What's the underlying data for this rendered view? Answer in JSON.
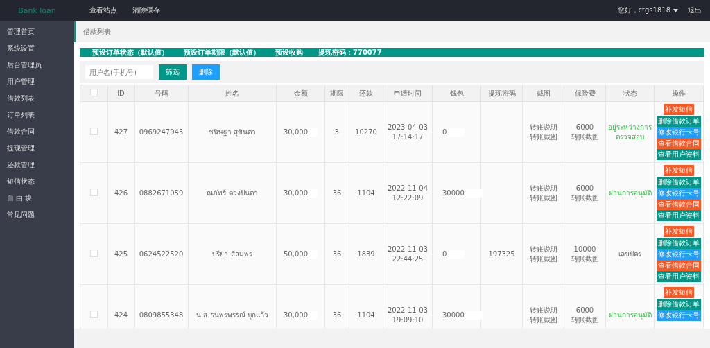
{
  "header": {
    "brand": "Bank loan",
    "nav": [
      "查看站点",
      "清除缓存"
    ],
    "user": "您好，ctgs1818",
    "logout": "退出"
  },
  "sidebar": {
    "items": [
      "管理首页",
      "系统设置",
      "后台管理员",
      "用户管理",
      "借款列表",
      "订单列表",
      "借款合同",
      "提现管理",
      "还款管理",
      "短信状态",
      "自 由 块",
      "常见问题"
    ]
  },
  "breadcrumb": "借款列表",
  "notice": [
    "预设订单状态（默认值）",
    "预设订单期限（默认值）",
    "预设收购",
    "提现密码：770077"
  ],
  "filter": {
    "placeholder": "用户名(手机号)",
    "buttons": [
      {
        "label": "筛选",
        "kind": "primary"
      },
      {
        "label": "删除",
        "kind": "info"
      }
    ]
  },
  "table": {
    "header_checked": false,
    "columns": [
      "ID",
      "号码",
      "姓名",
      "金额",
      "期限",
      "还款",
      "申请时间",
      "钱包",
      "提现密码",
      "截图",
      "保险费",
      "状态",
      "操作"
    ],
    "rows": [
      {
        "checked": false,
        "id": "427",
        "phone": "0969247945",
        "name": "ชนิษฐา สุขินตา",
        "amount": "30,000",
        "term": "3",
        "repay": "10270",
        "date": "2023-04-03",
        "time": "17:14:17",
        "wallet": "0",
        "shots": [
          "转账说明",
          "转账截图"
        ],
        "insurance": "6000",
        "insurance_link": "转账截图",
        "status": {
          "text": "อยู่ระหว่างการตรวจสอบ",
          "kind": "positive"
        },
        "actions": [
          {
            "label": "补发短信",
            "kind": "warn"
          },
          {
            "label": "删除借款订单",
            "kind": "primary"
          },
          {
            "label": "修改银行卡号",
            "kind": "info"
          },
          {
            "label": "查看借款合同",
            "kind": "warn"
          },
          {
            "label": "查看用户资料",
            "kind": "primary"
          }
        ]
      },
      {
        "checked": false,
        "id": "426",
        "phone": "0882671059",
        "name": "ณภัทร์ ดวงปินตา",
        "amount": "30,000",
        "term": "36",
        "repay": "1104",
        "date": "2022-11-04",
        "time": "12:22:09",
        "wallet": "30000",
        "shots": [
          "转账说明",
          "转账截图"
        ],
        "insurance": "6000",
        "insurance_link": "转账截图",
        "status": {
          "text": "ผ่านการอนุมัติ",
          "kind": "positive"
        },
        "actions": [
          {
            "label": "补发短信",
            "kind": "warn"
          },
          {
            "label": "删除借款订单",
            "kind": "primary"
          },
          {
            "label": "修改银行卡号",
            "kind": "info"
          },
          {
            "label": "查看借款合同",
            "kind": "warn"
          },
          {
            "label": "查看用户资料",
            "kind": "primary"
          }
        ]
      },
      {
        "checked": false,
        "id": "425",
        "phone": "0624522520",
        "name": "ปรียา สีสมพร",
        "amount": "50,000",
        "term": "36",
        "repay": "1839",
        "date": "2022-11-03",
        "time": "22:44:25",
        "wallet": "0",
        "withdraw_password": "197325",
        "shots": [
          "转账说明",
          "转账截图"
        ],
        "insurance": "10000",
        "insurance_link": "转账截图",
        "status": {
          "text": "เลขบัตร",
          "kind": "neutral"
        },
        "actions": [
          {
            "label": "补发短信",
            "kind": "warn"
          },
          {
            "label": "删除借款订单",
            "kind": "primary"
          },
          {
            "label": "修改银行卡号",
            "kind": "info"
          },
          {
            "label": "查看借款合同",
            "kind": "warn"
          },
          {
            "label": "查看用户资料",
            "kind": "primary"
          }
        ]
      },
      {
        "checked": false,
        "id": "424",
        "phone": "0809855348",
        "name": "น.ส.ธนพรพรรณ์ บุกแก้ว",
        "amount": "30,000",
        "term": "36",
        "repay": "1104",
        "date": "2022-11-03",
        "time": "19:09:10",
        "wallet": "30000",
        "shots": [
          "转账说明",
          "转账截图"
        ],
        "insurance": "6000",
        "insurance_link": "转账截图",
        "status": {
          "text": "ผ่านการอนุมัติ",
          "kind": "positive"
        },
        "actions": [
          {
            "label": "补发短信",
            "kind": "warn"
          },
          {
            "label": "删除借款订单",
            "kind": "primary"
          },
          {
            "label": "修改银行卡号",
            "kind": "info"
          }
        ]
      }
    ]
  }
}
